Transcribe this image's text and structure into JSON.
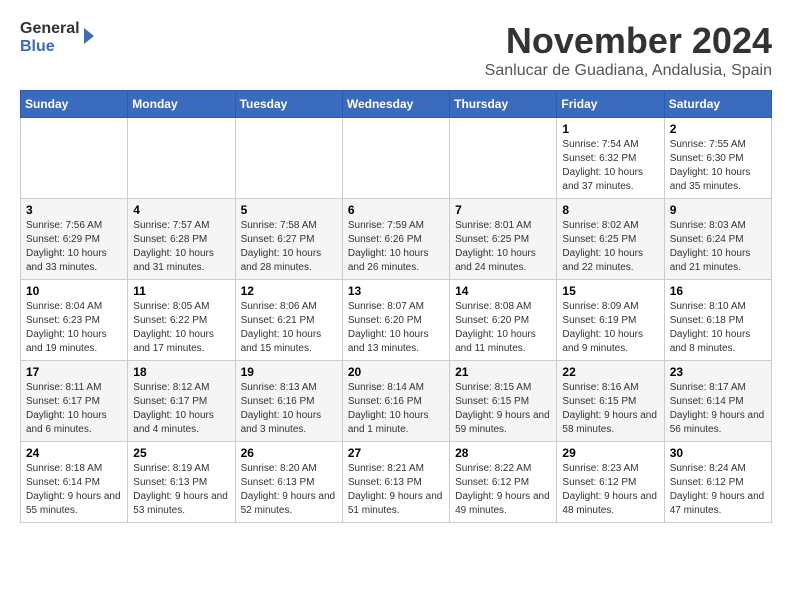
{
  "header": {
    "logo_line1": "General",
    "logo_line2": "Blue",
    "month_title": "November 2024",
    "location": "Sanlucar de Guadiana, Andalusia, Spain"
  },
  "days_of_week": [
    "Sunday",
    "Monday",
    "Tuesday",
    "Wednesday",
    "Thursday",
    "Friday",
    "Saturday"
  ],
  "weeks": [
    [
      {
        "day": "",
        "info": ""
      },
      {
        "day": "",
        "info": ""
      },
      {
        "day": "",
        "info": ""
      },
      {
        "day": "",
        "info": ""
      },
      {
        "day": "",
        "info": ""
      },
      {
        "day": "1",
        "info": "Sunrise: 7:54 AM\nSunset: 6:32 PM\nDaylight: 10 hours and 37 minutes."
      },
      {
        "day": "2",
        "info": "Sunrise: 7:55 AM\nSunset: 6:30 PM\nDaylight: 10 hours and 35 minutes."
      }
    ],
    [
      {
        "day": "3",
        "info": "Sunrise: 7:56 AM\nSunset: 6:29 PM\nDaylight: 10 hours and 33 minutes."
      },
      {
        "day": "4",
        "info": "Sunrise: 7:57 AM\nSunset: 6:28 PM\nDaylight: 10 hours and 31 minutes."
      },
      {
        "day": "5",
        "info": "Sunrise: 7:58 AM\nSunset: 6:27 PM\nDaylight: 10 hours and 28 minutes."
      },
      {
        "day": "6",
        "info": "Sunrise: 7:59 AM\nSunset: 6:26 PM\nDaylight: 10 hours and 26 minutes."
      },
      {
        "day": "7",
        "info": "Sunrise: 8:01 AM\nSunset: 6:25 PM\nDaylight: 10 hours and 24 minutes."
      },
      {
        "day": "8",
        "info": "Sunrise: 8:02 AM\nSunset: 6:25 PM\nDaylight: 10 hours and 22 minutes."
      },
      {
        "day": "9",
        "info": "Sunrise: 8:03 AM\nSunset: 6:24 PM\nDaylight: 10 hours and 21 minutes."
      }
    ],
    [
      {
        "day": "10",
        "info": "Sunrise: 8:04 AM\nSunset: 6:23 PM\nDaylight: 10 hours and 19 minutes."
      },
      {
        "day": "11",
        "info": "Sunrise: 8:05 AM\nSunset: 6:22 PM\nDaylight: 10 hours and 17 minutes."
      },
      {
        "day": "12",
        "info": "Sunrise: 8:06 AM\nSunset: 6:21 PM\nDaylight: 10 hours and 15 minutes."
      },
      {
        "day": "13",
        "info": "Sunrise: 8:07 AM\nSunset: 6:20 PM\nDaylight: 10 hours and 13 minutes."
      },
      {
        "day": "14",
        "info": "Sunrise: 8:08 AM\nSunset: 6:20 PM\nDaylight: 10 hours and 11 minutes."
      },
      {
        "day": "15",
        "info": "Sunrise: 8:09 AM\nSunset: 6:19 PM\nDaylight: 10 hours and 9 minutes."
      },
      {
        "day": "16",
        "info": "Sunrise: 8:10 AM\nSunset: 6:18 PM\nDaylight: 10 hours and 8 minutes."
      }
    ],
    [
      {
        "day": "17",
        "info": "Sunrise: 8:11 AM\nSunset: 6:17 PM\nDaylight: 10 hours and 6 minutes."
      },
      {
        "day": "18",
        "info": "Sunrise: 8:12 AM\nSunset: 6:17 PM\nDaylight: 10 hours and 4 minutes."
      },
      {
        "day": "19",
        "info": "Sunrise: 8:13 AM\nSunset: 6:16 PM\nDaylight: 10 hours and 3 minutes."
      },
      {
        "day": "20",
        "info": "Sunrise: 8:14 AM\nSunset: 6:16 PM\nDaylight: 10 hours and 1 minute."
      },
      {
        "day": "21",
        "info": "Sunrise: 8:15 AM\nSunset: 6:15 PM\nDaylight: 9 hours and 59 minutes."
      },
      {
        "day": "22",
        "info": "Sunrise: 8:16 AM\nSunset: 6:15 PM\nDaylight: 9 hours and 58 minutes."
      },
      {
        "day": "23",
        "info": "Sunrise: 8:17 AM\nSunset: 6:14 PM\nDaylight: 9 hours and 56 minutes."
      }
    ],
    [
      {
        "day": "24",
        "info": "Sunrise: 8:18 AM\nSunset: 6:14 PM\nDaylight: 9 hours and 55 minutes."
      },
      {
        "day": "25",
        "info": "Sunrise: 8:19 AM\nSunset: 6:13 PM\nDaylight: 9 hours and 53 minutes."
      },
      {
        "day": "26",
        "info": "Sunrise: 8:20 AM\nSunset: 6:13 PM\nDaylight: 9 hours and 52 minutes."
      },
      {
        "day": "27",
        "info": "Sunrise: 8:21 AM\nSunset: 6:13 PM\nDaylight: 9 hours and 51 minutes."
      },
      {
        "day": "28",
        "info": "Sunrise: 8:22 AM\nSunset: 6:12 PM\nDaylight: 9 hours and 49 minutes."
      },
      {
        "day": "29",
        "info": "Sunrise: 8:23 AM\nSunset: 6:12 PM\nDaylight: 9 hours and 48 minutes."
      },
      {
        "day": "30",
        "info": "Sunrise: 8:24 AM\nSunset: 6:12 PM\nDaylight: 9 hours and 47 minutes."
      }
    ]
  ]
}
